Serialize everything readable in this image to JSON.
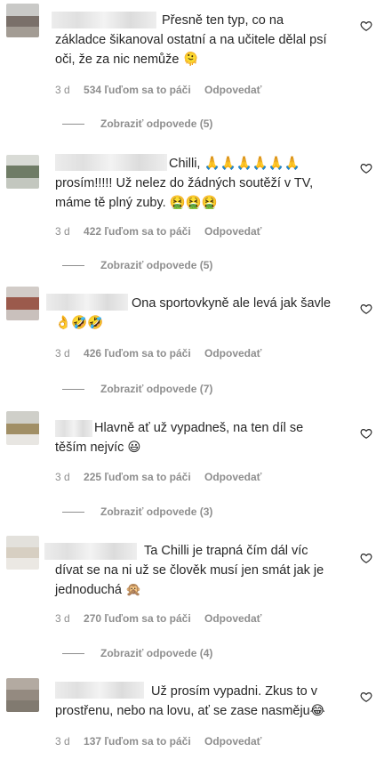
{
  "comments": [
    {
      "text": "Přesně ten typ, co na základce šikanoval ostatní a na učitele dělal psí oči, že za nic nemůže 🫠",
      "time": "3 d",
      "likes": "534 ľuďom sa to páči",
      "reply": "Odpovedať",
      "view_replies": "Zobraziť odpovede (5)"
    },
    {
      "text": "Chilli, 🙏🙏🙏🙏🙏🙏 prosím!!!!! Už nelez do žádných soutěží v TV, máme tě plný zuby. 🤮🤮🤮",
      "time": "3 d",
      "likes": "422 ľuďom sa to páči",
      "reply": "Odpovedať",
      "view_replies": "Zobraziť odpovede (5)"
    },
    {
      "text": "Ona sportovkyně ale levá jak šavle 👌🤣🤣",
      "time": "3 d",
      "likes": "426 ľuďom sa to páči",
      "reply": "Odpovedať",
      "view_replies": "Zobraziť odpovede (7)"
    },
    {
      "text": "Hlavně ať už vypadneš, na ten díl se těším nejvíc 😃",
      "time": "3 d",
      "likes": "225 ľuďom sa to páči",
      "reply": "Odpovedať",
      "view_replies": "Zobraziť odpovede (3)"
    },
    {
      "text": "Ta Chilli je trapná čím dál víc dívat se na ni už se člověk musí jen smát jak je jednoduchá 🙊",
      "time": "3 d",
      "likes": "270 ľuďom sa to páči",
      "reply": "Odpovedať",
      "view_replies": "Zobraziť odpovede (4)"
    },
    {
      "text": "Už prosím vypadni. Zkus to v prostřenu, nebo na lovu, ať se zase nasměju😂",
      "time": "3 d",
      "likes": "137 ľuďom sa to páči",
      "reply": "Odpovedať"
    }
  ],
  "icons": {
    "like": "heart-outline-icon"
  },
  "colors": {
    "text": "#262626",
    "secondary": "#8e8e8e",
    "background": "#ffffff"
  }
}
